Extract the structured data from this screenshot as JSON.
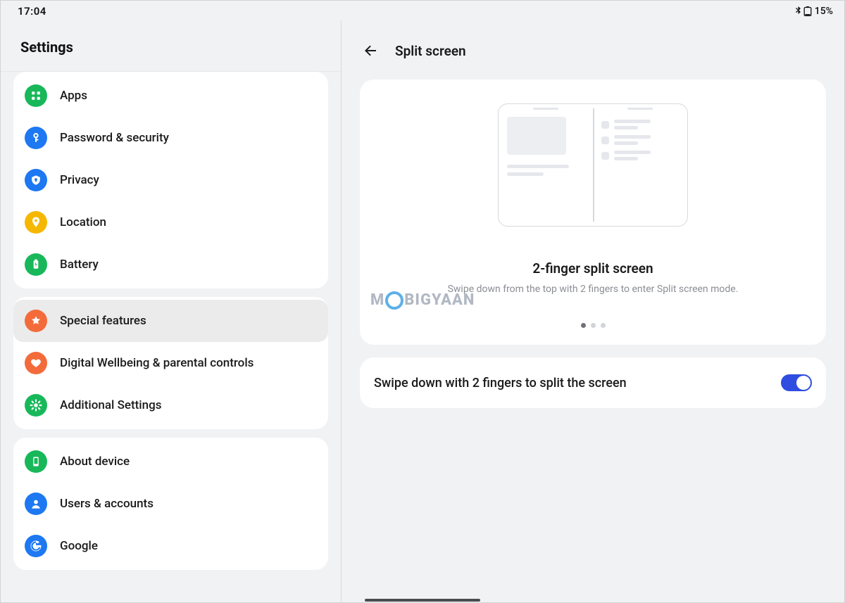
{
  "status": {
    "time": "17:04",
    "battery_pct": "15%"
  },
  "left": {
    "title": "Settings",
    "groups": [
      {
        "items": [
          {
            "id": "apps",
            "label": "Apps",
            "icon": "apps",
            "color": "#18b85a"
          },
          {
            "id": "password",
            "label": "Password & security",
            "icon": "key",
            "color": "#1d78f2"
          },
          {
            "id": "privacy",
            "label": "Privacy",
            "icon": "privacy",
            "color": "#1d78f2"
          },
          {
            "id": "location",
            "label": "Location",
            "icon": "location",
            "color": "#f5b700"
          },
          {
            "id": "battery",
            "label": "Battery",
            "icon": "battery",
            "color": "#18b85a"
          }
        ]
      },
      {
        "items": [
          {
            "id": "special",
            "label": "Special features",
            "icon": "star",
            "color": "#f36b3b",
            "selected": true
          },
          {
            "id": "wellbeing",
            "label": "Digital Wellbeing & parental controls",
            "icon": "heart",
            "color": "#f36b3b"
          },
          {
            "id": "additional",
            "label": "Additional Settings",
            "icon": "gear",
            "color": "#18b85a"
          }
        ]
      },
      {
        "items": [
          {
            "id": "about",
            "label": "About device",
            "icon": "device",
            "color": "#18b85a"
          },
          {
            "id": "users",
            "label": "Users & accounts",
            "icon": "person",
            "color": "#1d78f2"
          },
          {
            "id": "google",
            "label": "Google",
            "icon": "google",
            "color": "#1d78f2"
          }
        ]
      }
    ]
  },
  "right": {
    "title": "Split screen",
    "illustration_title": "2-finger split screen",
    "illustration_sub": "Swipe down from the top with 2 fingers to enter Split screen mode.",
    "page_count": 3,
    "page_index": 0,
    "toggle_label": "Swipe down with 2 fingers to split the screen",
    "toggle_on": true
  },
  "watermark": {
    "pre": "M",
    "post": "BIGYAAN"
  }
}
